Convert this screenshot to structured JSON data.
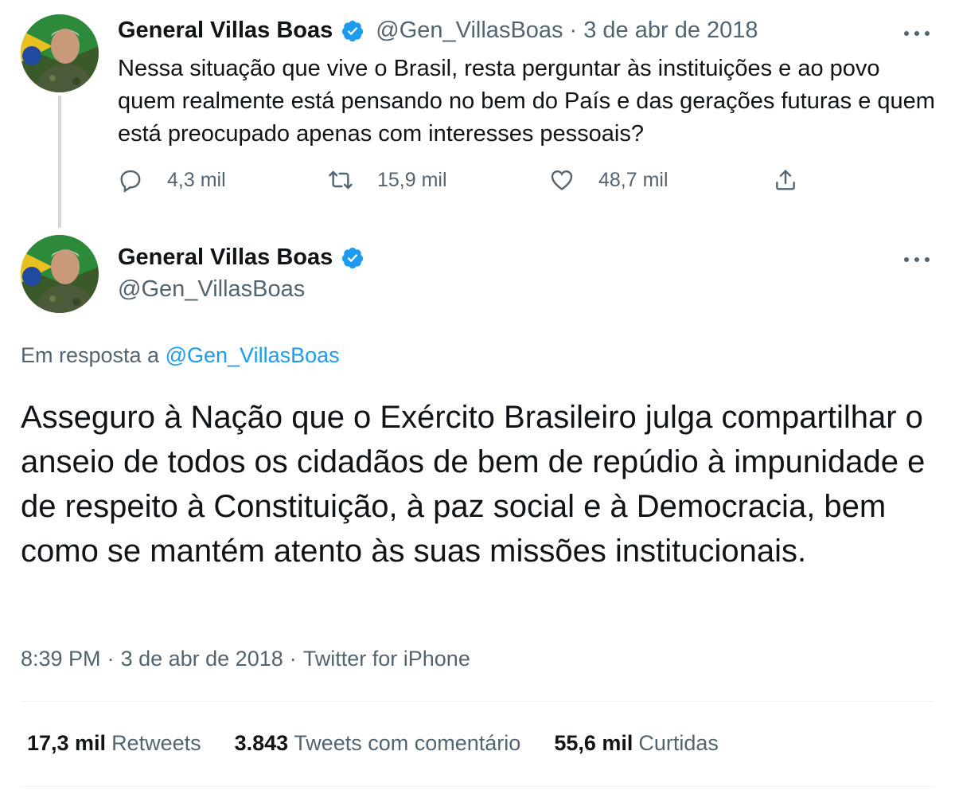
{
  "colors": {
    "accent": "#1d9bf0",
    "text_primary": "#0f1419",
    "text_secondary": "#536471",
    "thread_line": "#cfd9de"
  },
  "tweet_parent": {
    "author": {
      "display_name": "General Villas Boas",
      "handle": "@Gen_VillasBoas",
      "verified_icon": "verified-badge-icon",
      "avatar_icon": "avatar"
    },
    "separator": "·",
    "date": "3 de abr de 2018",
    "text": "Nessa situação que vive o Brasil, resta perguntar às instituições e ao povo quem realmente está pensando no bem do País e das gerações futuras e quem está preocupado apenas com interesses pessoais?",
    "actions": {
      "reply": {
        "icon": "reply-icon",
        "count": "4,3 mil"
      },
      "retweet": {
        "icon": "retweet-icon",
        "count": "15,9 mil"
      },
      "like": {
        "icon": "heart-icon",
        "count": "48,7 mil"
      },
      "share": {
        "icon": "share-icon"
      }
    }
  },
  "tweet_main": {
    "author": {
      "display_name": "General Villas Boas",
      "handle": "@Gen_VillasBoas",
      "verified_icon": "verified-badge-icon",
      "avatar_icon": "avatar"
    },
    "reply_prefix": "Em resposta a",
    "reply_mention": "@Gen_VillasBoas",
    "text": "Asseguro à Nação que o Exército Brasileiro julga compartilhar o anseio de todos os cidadãos de bem de repúdio à impunidade e de respeito à Constituição, à paz social e à Democracia, bem como se mantém atento às suas missões institucionais.",
    "time": "8:39 PM",
    "separator": "·",
    "date": "3 de abr de 2018",
    "source": "Twitter for iPhone",
    "stats": {
      "retweets": {
        "num": "17,3 mil",
        "label": "Retweets"
      },
      "quotes": {
        "num": "3.843",
        "label": "Tweets com comentário"
      },
      "likes": {
        "num": "55,6 mil",
        "label": "Curtidas"
      }
    }
  }
}
